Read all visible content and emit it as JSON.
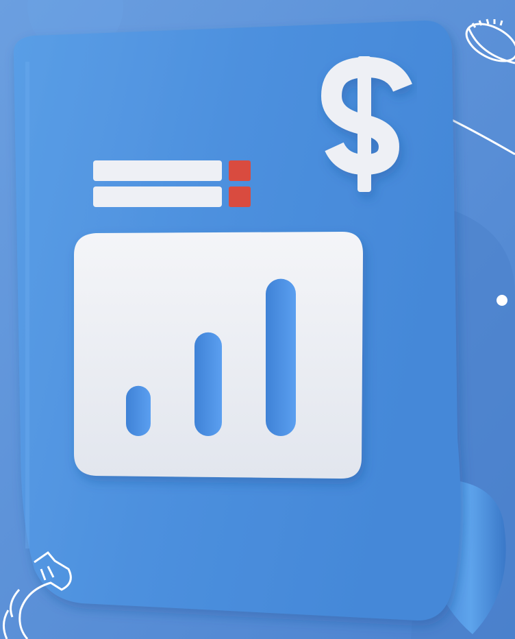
{
  "scene": {
    "subject": "financial-report-document",
    "palette": {
      "background": "#5a8fd6",
      "paper": "#4f93de",
      "paper_highlight": "#6aa9ea",
      "card": "#eef0f5",
      "bars": "#4c8fe0",
      "accent_red": "#d94b3f",
      "outline_white": "#ffffff"
    },
    "symbols": {
      "currency": "$"
    },
    "chart_icon": {
      "type": "bar",
      "bar_levels": [
        0.3,
        0.62,
        0.94
      ]
    },
    "icons": [
      "dollar-sign-icon",
      "bar-chart-icon",
      "coin-outline-icon",
      "dollar-outline-icon"
    ]
  }
}
